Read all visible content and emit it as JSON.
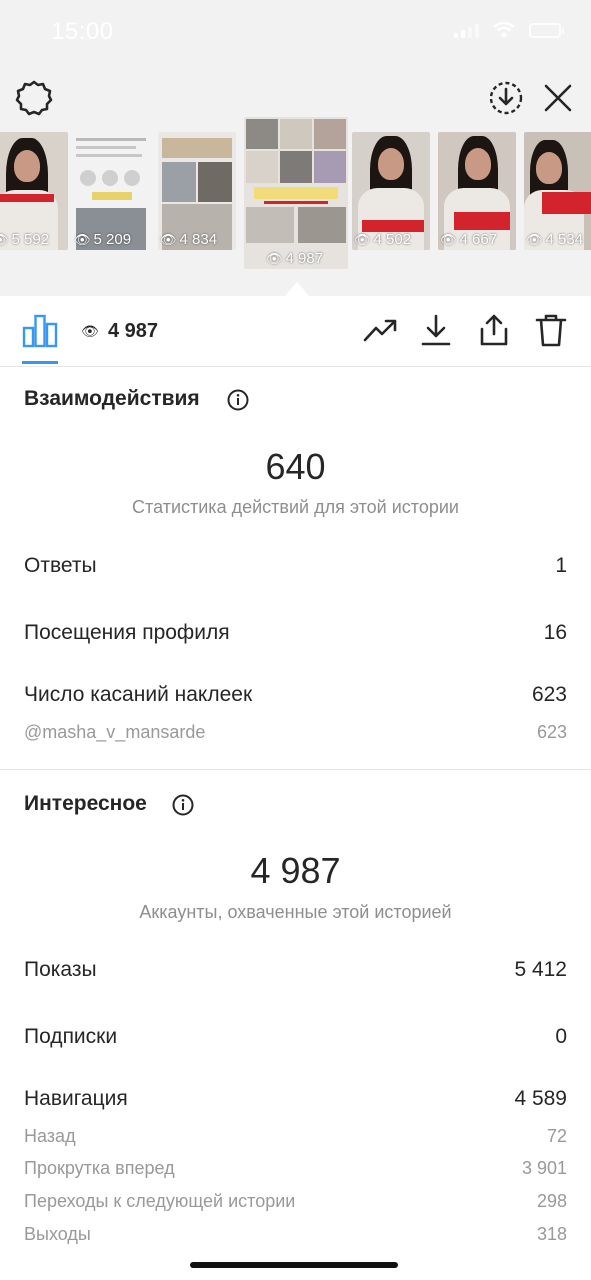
{
  "status_bar": {
    "time": "15:00"
  },
  "thumbnails": [
    {
      "views": "5 592",
      "tag": "@masha_v_mansarde"
    },
    {
      "views": "5 209"
    },
    {
      "views": "4 834"
    },
    {
      "views": "4 987",
      "tag": "@MASHA_V_MANSARDE",
      "selected": true
    },
    {
      "views": "4 502",
      "tag": "Постеры раздает"
    },
    {
      "views": "4 667"
    },
    {
      "views": "4 534"
    }
  ],
  "toolbar": {
    "view_count": "4 987"
  },
  "interactions": {
    "title": "Взаимодействия",
    "total": "640",
    "subtitle": "Статистика действий для этой истории",
    "rows": [
      {
        "label": "Ответы",
        "value": "1"
      },
      {
        "label": "Посещения профиля",
        "value": "16"
      },
      {
        "label": "Число касаний наклеек",
        "value": "623"
      }
    ],
    "sticker_sub": {
      "label": "@masha_v_mansarde",
      "value": "623"
    }
  },
  "discovery": {
    "title": "Интересное",
    "total": "4 987",
    "subtitle": "Аккаунты, охваченные этой историей",
    "rows": [
      {
        "label": "Показы",
        "value": "5 412"
      },
      {
        "label": "Подписки",
        "value": "0"
      },
      {
        "label": "Навигация",
        "value": "4 589"
      }
    ],
    "navigation_sub": [
      {
        "label": "Назад",
        "value": "72"
      },
      {
        "label": "Прокрутка вперед",
        "value": "3 901"
      },
      {
        "label": "Переходы к следующей истории",
        "value": "298"
      },
      {
        "label": "Выходы",
        "value": "318"
      }
    ]
  }
}
